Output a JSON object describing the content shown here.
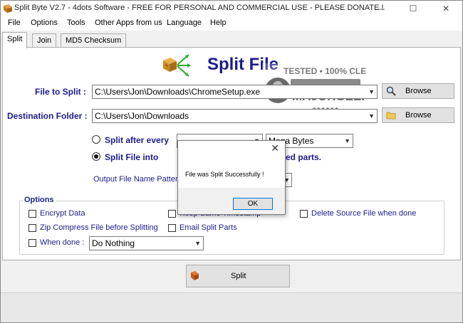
{
  "window": {
    "title": "Split Byte V2.7 - 4dots Software - FREE FOR PERSONAL AND COMMERCIAL USE - PLEASE DONATE !",
    "minimize_glyph": "—",
    "maximize_glyph": "☐",
    "close_glyph": "✕"
  },
  "menu": [
    "File",
    "Options",
    "Tools",
    "Other Apps from us",
    "Language",
    "Help"
  ],
  "tabs": [
    {
      "label": "Split",
      "active": true
    },
    {
      "label": "Join",
      "active": false
    },
    {
      "label": "MD5 Checksum",
      "active": false
    }
  ],
  "header": {
    "title": "Split File",
    "icon": "box-arrows-icon"
  },
  "watermark": {
    "line1": "TESTED • 100% CLEAN",
    "line2": "MAJORGEEKS",
    "stars": "★★★★★★"
  },
  "file_to_split": {
    "label": "File to Split :",
    "value": "C:\\Users\\Jon\\Downloads\\ChromeSetup.exe",
    "browse": "Browse",
    "icon": "magnifier-icon"
  },
  "destination": {
    "label": "Destination Folder :",
    "value": "C:\\Users\\Jon\\Downloads",
    "browse": "Browse",
    "icon": "folder-icon"
  },
  "split_after": {
    "label": "Split after every",
    "selected": false,
    "value": "",
    "unit": "Mega Bytes"
  },
  "split_into": {
    "label": "Split File into",
    "selected": true,
    "suffix_visible": "ed parts."
  },
  "output_pattern": {
    "label_visible": "Output File Name Pattern"
  },
  "options": {
    "title": "Options",
    "encrypt": {
      "label": "Encrypt Data",
      "checked": false
    },
    "keep_timestamp": {
      "label_visible": "Keep Same Timestamp",
      "checked": false
    },
    "delete_source": {
      "label": "Delete Source File when done",
      "checked": false
    },
    "zip": {
      "label": "Zip Compress File before Splitting",
      "checked": false
    },
    "email": {
      "label": "Email Split Parts",
      "checked": false
    },
    "when_done": {
      "label": "When done :",
      "checked": false,
      "value": "Do Nothing"
    }
  },
  "dialog": {
    "message": "File was Split Successfully !",
    "ok": "OK",
    "close_glyph": "✕"
  },
  "split_button": {
    "label": "Split",
    "icon": "split-file-icon"
  },
  "colors": {
    "label_blue": "#1c1c8c",
    "button_face": "#e1e1e1",
    "dialog_ok_border": "#0078d7"
  }
}
